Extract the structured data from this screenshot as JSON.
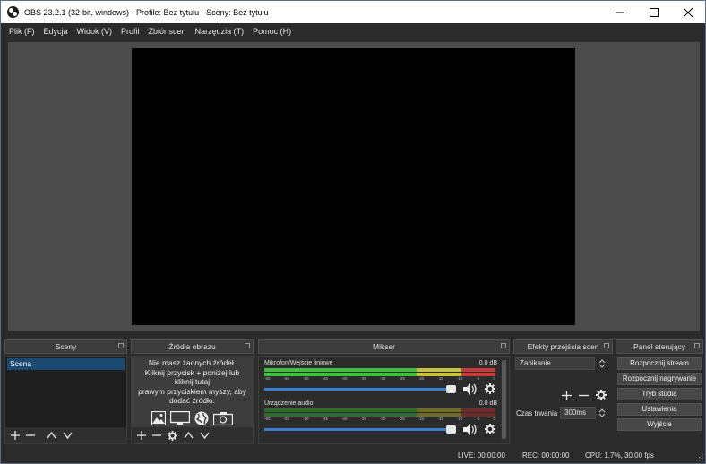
{
  "window": {
    "title": "OBS 23.2.1 (32-bit, windows) - Profile: Bez tytułu - Sceny: Bez tytułu",
    "minimize": "—",
    "maximize": "☐",
    "close": "✕"
  },
  "menu": [
    "Plik (F)",
    "Edycja",
    "Widok (V)",
    "Profil",
    "Zbiór scen",
    "Narzędzia (T)",
    "Pomoc (H)"
  ],
  "docks": {
    "scenes": {
      "title": "Sceny",
      "items": [
        "Scena"
      ]
    },
    "sources": {
      "title": "Źródła obrazu",
      "empty_lines": [
        "Nie masz żadnych źródeł.",
        "Kliknij przycisk + poniżej lub",
        "kliknij tutaj",
        "prawym przyciskiem myszy, aby",
        "dodać źródło."
      ]
    },
    "mixer": {
      "title": "Mikser",
      "channels": [
        {
          "name": "Mikrofon/Wejście liniowe",
          "db": "0.0 dB",
          "volume": 1.0
        },
        {
          "name": "Urządzenie audio",
          "db": "0.0 dB",
          "volume": 1.0
        }
      ],
      "scale": [
        "-60",
        "-55",
        "-50",
        "-45",
        "-40",
        "-35",
        "-30",
        "-25",
        "-20",
        "-15",
        "-10",
        "-5",
        "0"
      ]
    },
    "transitions": {
      "title": "Efekty przejścia scen",
      "selected": "Zanikanie",
      "duration_label": "Czas trwania",
      "duration_value": "300ms"
    },
    "controls": {
      "title": "Panel sterujący",
      "buttons": [
        "Rozpocznij stream",
        "Rozpocznij nagrywanie",
        "Tryb studia",
        "Ustawienia",
        "Wyjście"
      ]
    }
  },
  "status": {
    "live": "LIVE: 00:00:00",
    "rec": "REC: 00:00:00",
    "cpu": "CPU: 1.7%, 30.00 fps"
  },
  "colors": {
    "bg": "#2b2b2b",
    "preview": "#4b4b4b",
    "selected": "#1a4a72",
    "meter_green": "#3fbf3f",
    "meter_yellow": "#c7c23a",
    "meter_red": "#c73a3a",
    "volume": "#3a7fd0"
  }
}
